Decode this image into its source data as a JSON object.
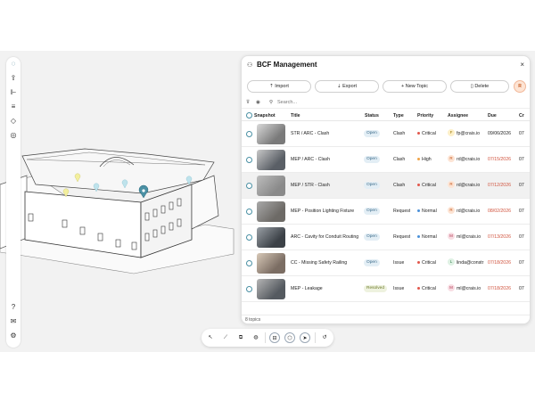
{
  "sidebar": {
    "items": [
      {
        "name": "logo-icon",
        "glyph": "◌"
      },
      {
        "name": "upload-icon",
        "glyph": "⇪"
      },
      {
        "name": "hierarchy-icon",
        "glyph": "⊩"
      },
      {
        "name": "list-icon",
        "glyph": "≡"
      },
      {
        "name": "layers-icon",
        "glyph": "◇"
      },
      {
        "name": "comment-icon",
        "glyph": "◎"
      },
      {
        "name": "help-icon",
        "glyph": "?"
      },
      {
        "name": "mail-icon",
        "glyph": "✉"
      },
      {
        "name": "settings-icon",
        "glyph": "⚙"
      }
    ]
  },
  "panel": {
    "title": "BCF Management",
    "close_glyph": "×",
    "title_icon": "⚇",
    "buttons": {
      "import": "⇡ Import",
      "export": "⇣ Export",
      "new_topic": "+ New Topic",
      "delete": "▯ Delete"
    },
    "avatar": "R",
    "search_placeholder": "Search...",
    "filter_glyph": "⊽",
    "eye_glyph": "◉",
    "search_glyph": "⚲",
    "columns": {
      "snapshot": "Snapshot",
      "title": "Title",
      "status": "Status",
      "type": "Type",
      "priority": "Priority",
      "assignee": "Assignee",
      "due": "Due",
      "cr": "Cr"
    },
    "rows": [
      {
        "title": "STR / ARC - Clash",
        "status": "Open",
        "status_kind": "open",
        "type": "Clash",
        "priority": "Critical",
        "priority_color": "#e2574c",
        "assignee_initial": "F",
        "assignee_bg": "#fdf0c9",
        "assignee_fg": "#9a7400",
        "assignee": "fp@crais.io",
        "due": "09/06/2026",
        "due_overdue": false,
        "cr": "07"
      },
      {
        "title": "MEP / ARC - Clash",
        "status": "Open",
        "status_kind": "open",
        "type": "Clash",
        "priority": "High",
        "priority_color": "#f0a347",
        "assignee_initial": "R",
        "assignee_bg": "#fde4d4",
        "assignee_fg": "#c4561b",
        "assignee": "rd@crais.io",
        "due": "07/15/2026",
        "due_overdue": true,
        "cr": "07"
      },
      {
        "title": "MEP / STR - Clash",
        "status": "Open",
        "status_kind": "open",
        "type": "Clash",
        "priority": "Critical",
        "priority_color": "#e2574c",
        "assignee_initial": "R",
        "assignee_bg": "#fde4d4",
        "assignee_fg": "#c4561b",
        "assignee": "rd@crais.io",
        "due": "07/12/2026",
        "due_overdue": true,
        "cr": "07"
      },
      {
        "title": "MEP - Position Lighting Fixture",
        "status": "Open",
        "status_kind": "open",
        "type": "Request",
        "priority": "Normal",
        "priority_color": "#4a90d9",
        "assignee_initial": "R",
        "assignee_bg": "#fde4d4",
        "assignee_fg": "#c4561b",
        "assignee": "rd@crais.io",
        "due": "08/02/2026",
        "due_overdue": true,
        "cr": "07"
      },
      {
        "title": "ARC - Cavity for Conduit Routing",
        "status": "Open",
        "status_kind": "open",
        "type": "Request",
        "priority": "Normal",
        "priority_color": "#4a90d9",
        "assignee_initial": "M",
        "assignee_bg": "#f8dde3",
        "assignee_fg": "#b23b55",
        "assignee": "ml@crais.io",
        "due": "07/13/2026",
        "due_overdue": true,
        "cr": "07"
      },
      {
        "title": "CC - Missing Safety Railing",
        "status": "Open",
        "status_kind": "open",
        "type": "Issue",
        "priority": "Critical",
        "priority_color": "#e2574c",
        "assignee_initial": "L",
        "assignee_bg": "#dff1e4",
        "assignee_fg": "#2f7d47",
        "assignee": "linda@constr",
        "due": "07/18/2026",
        "due_overdue": true,
        "cr": "07"
      },
      {
        "title": "MEP - Leakage",
        "status": "Resolved",
        "status_kind": "resolved",
        "type": "Issue",
        "priority": "Critical",
        "priority_color": "#e2574c",
        "assignee_initial": "M",
        "assignee_bg": "#f8dde3",
        "assignee_fg": "#b23b55",
        "assignee": "ml@crais.io",
        "due": "07/18/2026",
        "due_overdue": true,
        "cr": "07"
      }
    ],
    "footer": "8 topics"
  },
  "toolbar": {
    "tools": [
      {
        "name": "select-icon",
        "glyph": "↖",
        "boxed": false
      },
      {
        "name": "measure-icon",
        "glyph": "⟋",
        "boxed": false
      },
      {
        "name": "section-icon",
        "glyph": "⧉",
        "boxed": false
      },
      {
        "name": "markup-icon",
        "glyph": "◍",
        "boxed": false
      },
      {
        "name": "bcf-icon",
        "glyph": "⊟",
        "boxed": true
      },
      {
        "name": "model-icon",
        "glyph": "⬡",
        "boxed": true
      },
      {
        "name": "send-icon",
        "glyph": "➤",
        "boxed": true
      },
      {
        "name": "reset-icon",
        "glyph": "↺",
        "boxed": false
      }
    ]
  }
}
